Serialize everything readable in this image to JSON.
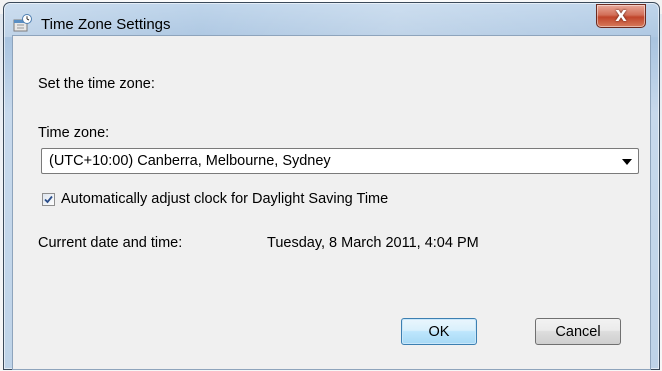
{
  "window": {
    "title": "Time Zone Settings",
    "close_glyph": "X",
    "icon": "clock-settings-icon"
  },
  "content": {
    "intro": "Set the time zone:",
    "timezone_label": "Time zone:",
    "timezone_value": "(UTC+10:00) Canberra, Melbourne, Sydney",
    "dst_checkbox_label": "Automatically adjust clock for Daylight Saving Time",
    "dst_checked": true,
    "current_label": "Current date and time:",
    "current_value": "Tuesday, 8 March 2011, 4:04 PM"
  },
  "buttons": {
    "ok": "OK",
    "cancel": "Cancel"
  },
  "colors": {
    "default_button_border": "#3c7fb1",
    "close_button": "#c0452b"
  }
}
